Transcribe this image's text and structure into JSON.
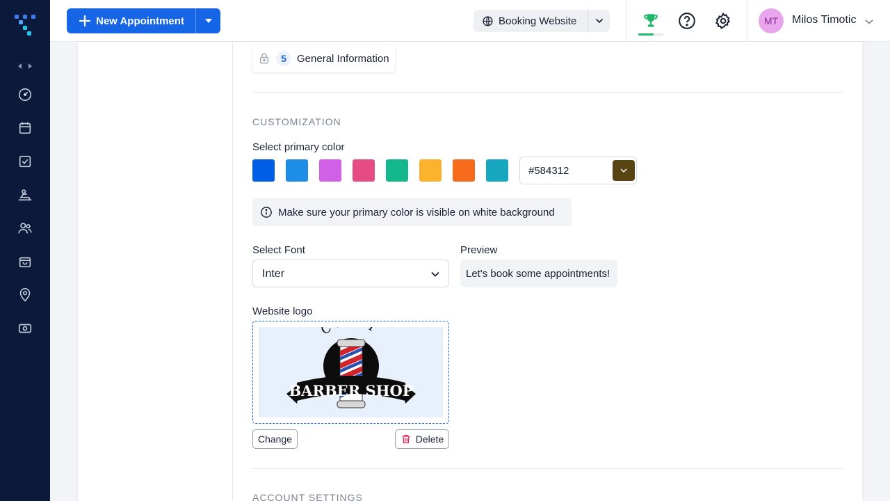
{
  "topbar": {
    "new_appointment_label": "New Appointment",
    "booking_website_label": "Booking Website",
    "user": {
      "initials": "MT",
      "name": "Milos Timotic"
    }
  },
  "sidebar": {
    "items": [
      {
        "icon": "dashboard-icon"
      },
      {
        "icon": "calendar-icon"
      },
      {
        "icon": "task-check-icon"
      },
      {
        "icon": "services-icon"
      },
      {
        "icon": "customers-icon"
      },
      {
        "icon": "shop-bag-icon"
      },
      {
        "icon": "location-icon"
      },
      {
        "icon": "finance-icon"
      }
    ]
  },
  "step": {
    "number": "5",
    "label": "General Information"
  },
  "customization": {
    "section_title": "CUSTOMIZATION",
    "primary_color_label": "Select primary color",
    "swatches": [
      "#005ee6",
      "#1e8de6",
      "#d060e6",
      "#e64c82",
      "#14b88a",
      "#fbb22c",
      "#f76b1c",
      "#17a8c0"
    ],
    "hex_value": "#584312",
    "hex_color": "#584312",
    "info_text": "Make sure your primary color is visible on white background",
    "font_label": "Select Font",
    "font_value": "Inter",
    "preview_label": "Preview",
    "preview_text": "Let's book some appointments!",
    "logo_label": "Website logo",
    "logo_text_top": "CARY",
    "logo_text_main": "BARBER SHOP",
    "change_label": "Change",
    "delete_label": "Delete"
  },
  "account_settings": {
    "section_title": "ACCOUNT SETTINGS"
  },
  "colors": {
    "brand": "#1565e6",
    "sidebar": "#0b1a3a",
    "trophy": "#1fb86a",
    "delete": "#e0245e"
  }
}
